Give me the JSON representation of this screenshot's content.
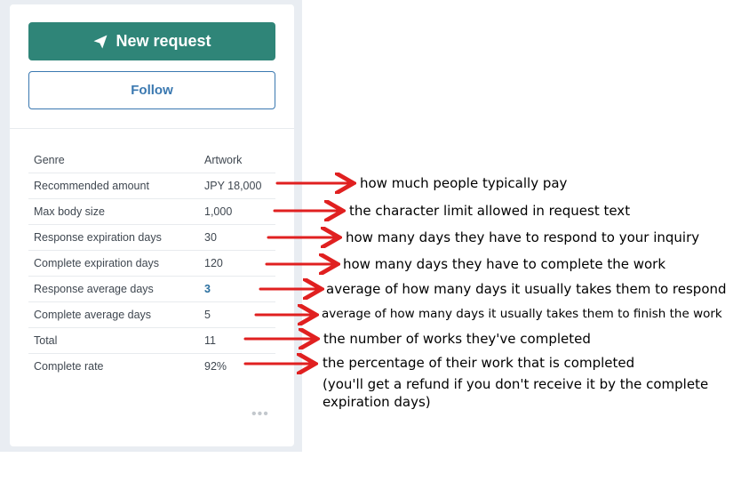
{
  "card": {
    "new_request_label": "New request",
    "follow_label": "Follow",
    "more_label": "•••",
    "rows": [
      {
        "label": "Genre",
        "value": "Artwork"
      },
      {
        "label": "Recommended amount",
        "value": "JPY 18,000"
      },
      {
        "label": "Max body size",
        "value": "1,000"
      },
      {
        "label": "Response expiration days",
        "value": "30"
      },
      {
        "label": "Complete expiration days",
        "value": "120"
      },
      {
        "label": "Response average days",
        "value": "3"
      },
      {
        "label": "Complete average days",
        "value": "5"
      },
      {
        "label": "Total",
        "value": "11"
      },
      {
        "label": "Complete rate",
        "value": "92%"
      }
    ]
  },
  "annotations": {
    "recommended_amount": "how much people typically pay",
    "max_body_size": "the character limit allowed in request text",
    "response_expiration": "how many days they have to respond to your inquiry",
    "complete_expiration": "how many days they have to complete the work",
    "response_average": "average of how many days it usually takes them to respond",
    "complete_average": "average of how many days it usually takes them to finish the work",
    "total": "the number of works they've completed",
    "complete_rate_line1": "the percentage of their work that is completed",
    "complete_rate_line2": "(you'll get a refund if you don't receive it by the complete expiration days)"
  },
  "colors": {
    "primary": "#2f8578",
    "link": "#3a78b0",
    "arrow": "#e02020"
  },
  "icons": {
    "new_request": "paper-plane-icon",
    "more": "more-dots-icon"
  }
}
